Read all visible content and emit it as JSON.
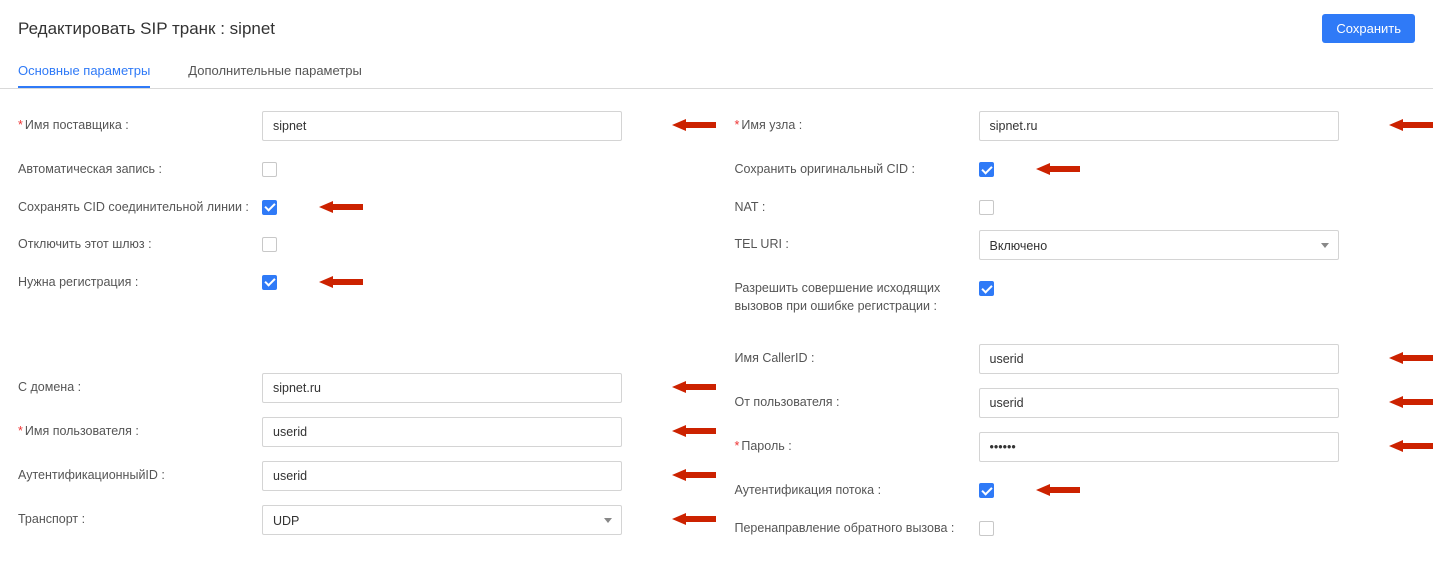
{
  "page": {
    "title": "Редактировать SIP транк : sipnet",
    "save_button": "Сохранить"
  },
  "tabs": {
    "main": "Основные параметры",
    "extra": "Дополнительные параметры"
  },
  "left": {
    "provider_name_label": "Имя поставщика :",
    "provider_name_value": "sipnet",
    "auto_record_label": "Автоматическая запись :",
    "auto_record_checked": false,
    "keep_trunk_cid_label": "Сохранять CID соединительной линии :",
    "keep_trunk_cid_checked": true,
    "disable_gateway_label": "Отключить этот шлюз :",
    "disable_gateway_checked": false,
    "need_registration_label": "Нужна регистрация :",
    "need_registration_checked": true,
    "from_domain_label": "С домена :",
    "from_domain_value": "sipnet.ru",
    "username_label": "Имя пользователя :",
    "username_value": "userid",
    "auth_id_label": "АутентификационныйID :",
    "auth_id_value": "userid",
    "transport_label": "Транспорт :",
    "transport_value": "UDP"
  },
  "right": {
    "host_label": "Имя узла :",
    "host_value": "sipnet.ru",
    "keep_orig_cid_label": "Сохранить оригинальный CID :",
    "keep_orig_cid_checked": true,
    "nat_label": "NAT :",
    "nat_checked": false,
    "tel_uri_label": "TEL URI :",
    "tel_uri_value": "Включено",
    "allow_outgoing_on_reg_error_label": "Разрешить совершение исходящих вызовов при ошибке регистрации :",
    "allow_outgoing_on_reg_error_checked": true,
    "callerid_name_label": "Имя CallerID :",
    "callerid_name_value": "userid",
    "from_user_label": "От пользователя :",
    "from_user_value": "userid",
    "password_label": "Пароль :",
    "password_value_masked": "••••••",
    "auth_stream_label": "Аутентификация потока :",
    "auth_stream_checked": true,
    "call_forward_label": "Перенаправление обратного вызова :",
    "call_forward_checked": false
  }
}
